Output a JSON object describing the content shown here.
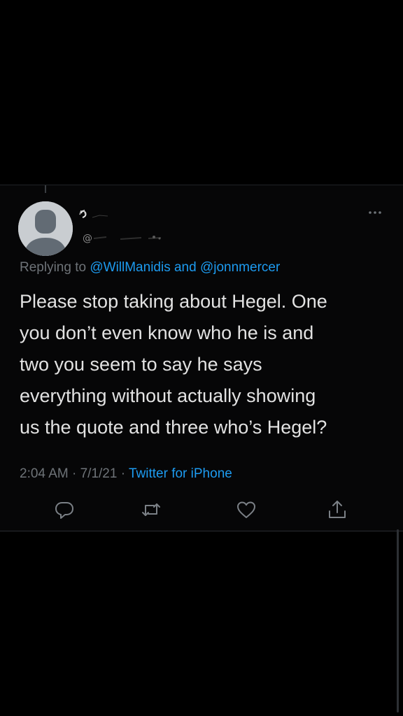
{
  "tweet": {
    "reply_prefix": "Replying to",
    "mentions": [
      "@WillManidis",
      "@jonnmercer"
    ],
    "mention_joiner": "and",
    "text_lines": [
      "Please stop taking about Hegel. One",
      "you don’t even know who he is and",
      "two you seem to say he says",
      "everything without actually showing",
      "us the quote and three who’s Hegel?"
    ],
    "time": "2:04 AM",
    "date": "7/1/21",
    "separator": "·",
    "source": "Twitter for iPhone"
  },
  "icons": {
    "avatar": "default-avatar-icon",
    "more": "more-options-icon",
    "reply": "reply-icon",
    "retweet": "retweet-icon",
    "like": "heart-icon",
    "share": "share-icon"
  },
  "colors": {
    "background": "#000000",
    "link": "#1d9bf0",
    "muted": "#6e7378",
    "text": "#e2e2e2"
  }
}
